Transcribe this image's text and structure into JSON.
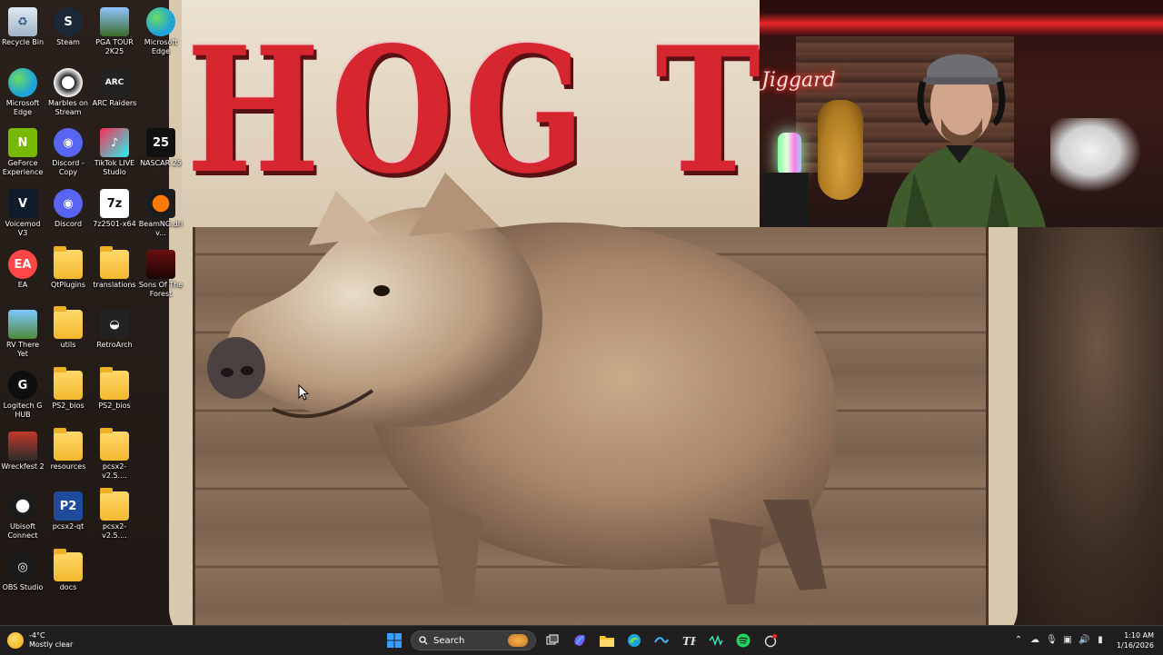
{
  "desktop": {
    "icons": [
      {
        "label": "Recycle Bin",
        "icon": "recycle-bin-icon",
        "col": 0,
        "row": 0
      },
      {
        "label": "Steam",
        "icon": "steam-icon",
        "col": 1,
        "row": 0
      },
      {
        "label": "PGA TOUR 2K25",
        "icon": "pga-tour-icon",
        "col": 2,
        "row": 0
      },
      {
        "label": "Microsoft Edge",
        "icon": "edge-icon",
        "col": 3,
        "row": 0
      },
      {
        "label": "Microsoft Edge",
        "icon": "edge-icon",
        "col": 0,
        "row": 1
      },
      {
        "label": "Marbles on Stream",
        "icon": "marbles-icon",
        "col": 1,
        "row": 1
      },
      {
        "label": "ARC Raiders",
        "icon": "arc-raiders-icon",
        "col": 2,
        "row": 1
      },
      {
        "label": "GeForce Experience",
        "icon": "geforce-icon",
        "col": 0,
        "row": 2
      },
      {
        "label": "Discord - Copy",
        "icon": "discord-icon",
        "col": 1,
        "row": 2
      },
      {
        "label": "TikTok LIVE Studio",
        "icon": "tiktok-icon",
        "col": 2,
        "row": 2
      },
      {
        "label": "NASCAR 25",
        "icon": "nascar-icon",
        "col": 3,
        "row": 2
      },
      {
        "label": "Voicemod V3",
        "icon": "voicemod-icon",
        "col": 0,
        "row": 3
      },
      {
        "label": "Discord",
        "icon": "discord-icon",
        "col": 1,
        "row": 3
      },
      {
        "label": "7z2501-x64",
        "icon": "7zip-icon",
        "col": 2,
        "row": 3
      },
      {
        "label": "BeamNG.driv...",
        "icon": "beamng-icon",
        "col": 3,
        "row": 3
      },
      {
        "label": "EA",
        "icon": "ea-icon",
        "col": 0,
        "row": 4
      },
      {
        "label": "QtPlugins",
        "icon": "folder-icon",
        "col": 1,
        "row": 4
      },
      {
        "label": "translations",
        "icon": "folder-icon",
        "col": 2,
        "row": 4
      },
      {
        "label": "Sons Of The Forest",
        "icon": "sons-of-the-forest-icon",
        "col": 3,
        "row": 4
      },
      {
        "label": "RV There Yet",
        "icon": "rv-there-yet-icon",
        "col": 0,
        "row": 5
      },
      {
        "label": "utils",
        "icon": "folder-icon",
        "col": 1,
        "row": 5
      },
      {
        "label": "RetroArch",
        "icon": "retroarch-icon",
        "col": 2,
        "row": 5
      },
      {
        "label": "Logitech G HUB",
        "icon": "logitech-icon",
        "col": 0,
        "row": 6
      },
      {
        "label": "PS2_bios",
        "icon": "folder-icon",
        "col": 1,
        "row": 6
      },
      {
        "label": "PS2_bios",
        "icon": "folder-icon",
        "col": 2,
        "row": 6
      },
      {
        "label": "Wreckfest 2",
        "icon": "wreckfest-icon",
        "col": 0,
        "row": 7
      },
      {
        "label": "resources",
        "icon": "folder-icon",
        "col": 1,
        "row": 7
      },
      {
        "label": "pcsx2-v2.5....",
        "icon": "folder-icon",
        "col": 2,
        "row": 7
      },
      {
        "label": "Ubisoft Connect",
        "icon": "ubisoft-icon",
        "col": 0,
        "row": 8
      },
      {
        "label": "pcsx2-qt",
        "icon": "pcsx2-icon",
        "col": 1,
        "row": 8
      },
      {
        "label": "pcsx2-v2.5....",
        "icon": "folder-icon",
        "col": 2,
        "row": 8
      },
      {
        "label": "OBS Studio",
        "icon": "obs-icon",
        "col": 0,
        "row": 9
      },
      {
        "label": "docs",
        "icon": "folder-icon",
        "col": 1,
        "row": 9
      }
    ]
  },
  "wallpaper": {
    "sign_text": "HOG TA",
    "accent": "#d62630"
  },
  "webcam": {
    "neon_text": "Jiggard"
  },
  "taskbar": {
    "weather": {
      "temp": "-4°C",
      "condition": "Mostly clear"
    },
    "search_placeholder": "Search",
    "clock": {
      "time": "1:10 AM",
      "date": "1/16/2026"
    }
  }
}
